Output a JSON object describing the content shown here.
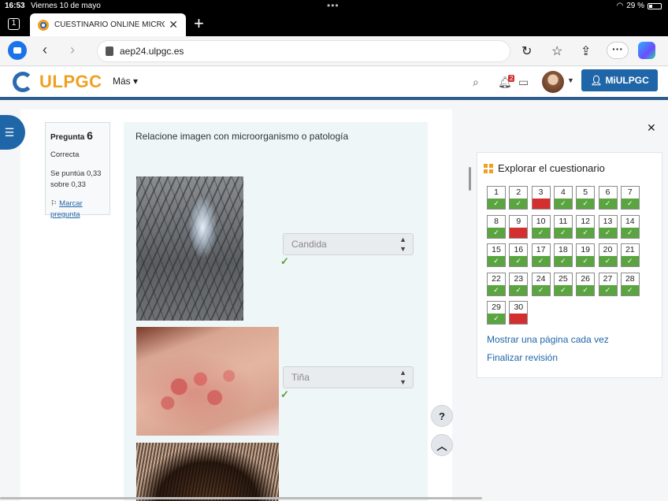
{
  "status_bar": {
    "time": "16:53",
    "date": "Viernes 10 de mayo",
    "battery": "29 %"
  },
  "browser": {
    "tab_count": "1",
    "tab_title": "CUESTINARIO ONLINE MICRO",
    "url": "aep24.ulpgc.es"
  },
  "site": {
    "logo_text": "ULPGC",
    "more_menu": "Más",
    "notification_count": "2",
    "user_button": "MiULPGC"
  },
  "question_info": {
    "label": "Pregunta",
    "number": "6",
    "state": "Correcta",
    "grade": "Se puntúa 0,33 sobre 0,33",
    "flag_label": "Marcar pregunta"
  },
  "question": {
    "text": "Relacione imagen con microorganismo o patología",
    "answers": [
      {
        "selected": "Candida"
      },
      {
        "selected": "Tiña"
      }
    ]
  },
  "help_button": "?",
  "navigation": {
    "title": "Explorar el cuestionario",
    "questions": [
      {
        "n": "1",
        "s": "correct"
      },
      {
        "n": "2",
        "s": "correct"
      },
      {
        "n": "3",
        "s": "wrong"
      },
      {
        "n": "4",
        "s": "correct"
      },
      {
        "n": "5",
        "s": "correct"
      },
      {
        "n": "6",
        "s": "correct"
      },
      {
        "n": "7",
        "s": "correct"
      },
      {
        "n": "8",
        "s": "correct"
      },
      {
        "n": "9",
        "s": "wrong"
      },
      {
        "n": "10",
        "s": "correct"
      },
      {
        "n": "11",
        "s": "correct"
      },
      {
        "n": "12",
        "s": "correct"
      },
      {
        "n": "13",
        "s": "correct"
      },
      {
        "n": "14",
        "s": "correct"
      },
      {
        "n": "15",
        "s": "correct"
      },
      {
        "n": "16",
        "s": "correct"
      },
      {
        "n": "17",
        "s": "correct"
      },
      {
        "n": "18",
        "s": "correct"
      },
      {
        "n": "19",
        "s": "correct"
      },
      {
        "n": "20",
        "s": "correct"
      },
      {
        "n": "21",
        "s": "correct"
      },
      {
        "n": "22",
        "s": "correct"
      },
      {
        "n": "23",
        "s": "correct"
      },
      {
        "n": "24",
        "s": "correct"
      },
      {
        "n": "25",
        "s": "correct"
      },
      {
        "n": "26",
        "s": "correct"
      },
      {
        "n": "27",
        "s": "correct"
      },
      {
        "n": "28",
        "s": "correct"
      },
      {
        "n": "29",
        "s": "correct"
      },
      {
        "n": "30",
        "s": "wrong"
      }
    ],
    "link_one_page": "Mostrar una página cada vez",
    "link_finish": "Finalizar revisión"
  },
  "colors": {
    "brand_blue": "#1f66a8",
    "brand_orange": "#f0a020",
    "correct": "#5aa540",
    "wrong": "#d32f2f"
  }
}
